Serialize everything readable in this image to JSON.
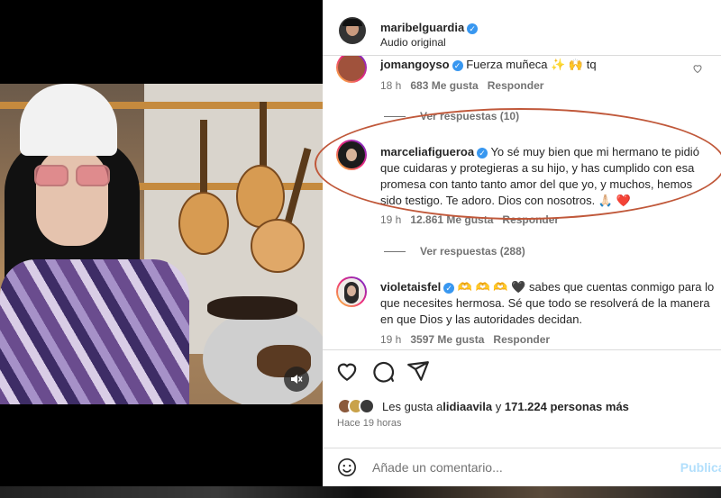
{
  "post": {
    "username": "maribelguardia",
    "subtitle": "Audio original"
  },
  "comments": [
    {
      "username": "jomangoyso",
      "text": "Fuerza muñeca ✨ 🙌 tq",
      "time": "18 h",
      "likes": "683 Me gusta",
      "reply": "Responder",
      "view_replies": "Ver respuestas (10)"
    },
    {
      "username": "marceliafigueroa",
      "text": "Yo sé muy bien que mi hermano te pidió que cuidaras y protegieras a su hijo, y has cumplido con esa promesa con tanto tanto amor del que yo, y muchos, hemos sido testigo. Te adoro. Dios con nosotros. 🙏🏻 ❤️",
      "time": "19 h",
      "likes": "12.861 Me gusta",
      "reply": "Responder",
      "view_replies": "Ver respuestas (288)"
    },
    {
      "username": "violetaisfel",
      "text": "🫶 🫶 🫶 🖤 sabes que cuentas conmigo para lo que necesites hermosa. Sé que todo se resolverá de la manera en que Dios y las autoridades decidan.",
      "time": "19 h",
      "likes": "3597 Me gusta",
      "reply": "Responder"
    }
  ],
  "likes_summary": {
    "prefix": "Les gusta a ",
    "user": "lidiaavila",
    "middle": " y ",
    "count": "171.224 personas más"
  },
  "time_ago": "Hace 19 horas",
  "add_comment": {
    "placeholder": "Añade un comentario...",
    "post_label": "Publicar"
  },
  "colors": {
    "verified": "#3897f0",
    "highlight": "#c0583a",
    "like_red": "#ed4956"
  },
  "icons": [
    "heart-icon",
    "comment-icon",
    "share-icon",
    "emoji-icon",
    "mute-icon",
    "verified-icon"
  ]
}
